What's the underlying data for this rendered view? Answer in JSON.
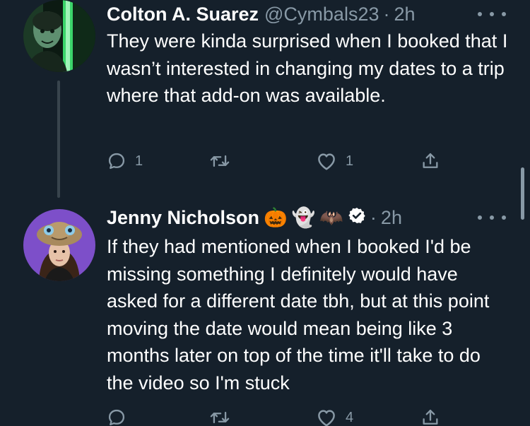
{
  "tweets": [
    {
      "display_name": "Colton A. Suarez",
      "handle": "@Cymbals23",
      "separator": "·",
      "time": "2h",
      "body": "They were kinda surprised when I booked that I wasn’t interested in changing my dates to a trip where that add-on was available.",
      "reply_count": "1",
      "retweet_count": "",
      "like_count": "1",
      "verified": false
    },
    {
      "display_name": "Jenny Nicholson",
      "name_emojis": [
        "🎃",
        "👻",
        "🦇"
      ],
      "handle": "",
      "separator": "·",
      "time": "2h",
      "body": "If they had mentioned when I booked I'd be missing something I definitely would have asked for a different date tbh, but at this point moving the date would mean being like 3 months later on top of the time it'll take to do the video so I'm stuck",
      "reply_count": "",
      "retweet_count": "",
      "like_count": "4",
      "verified": true
    }
  ],
  "theme": {
    "background": "#15202b",
    "text": "#ffffff",
    "secondary_text": "#8899a6",
    "thread_line": "#38444d"
  },
  "icons": [
    "reply-icon",
    "retweet-icon",
    "like-icon",
    "share-icon",
    "more-icon",
    "verified-icon"
  ]
}
